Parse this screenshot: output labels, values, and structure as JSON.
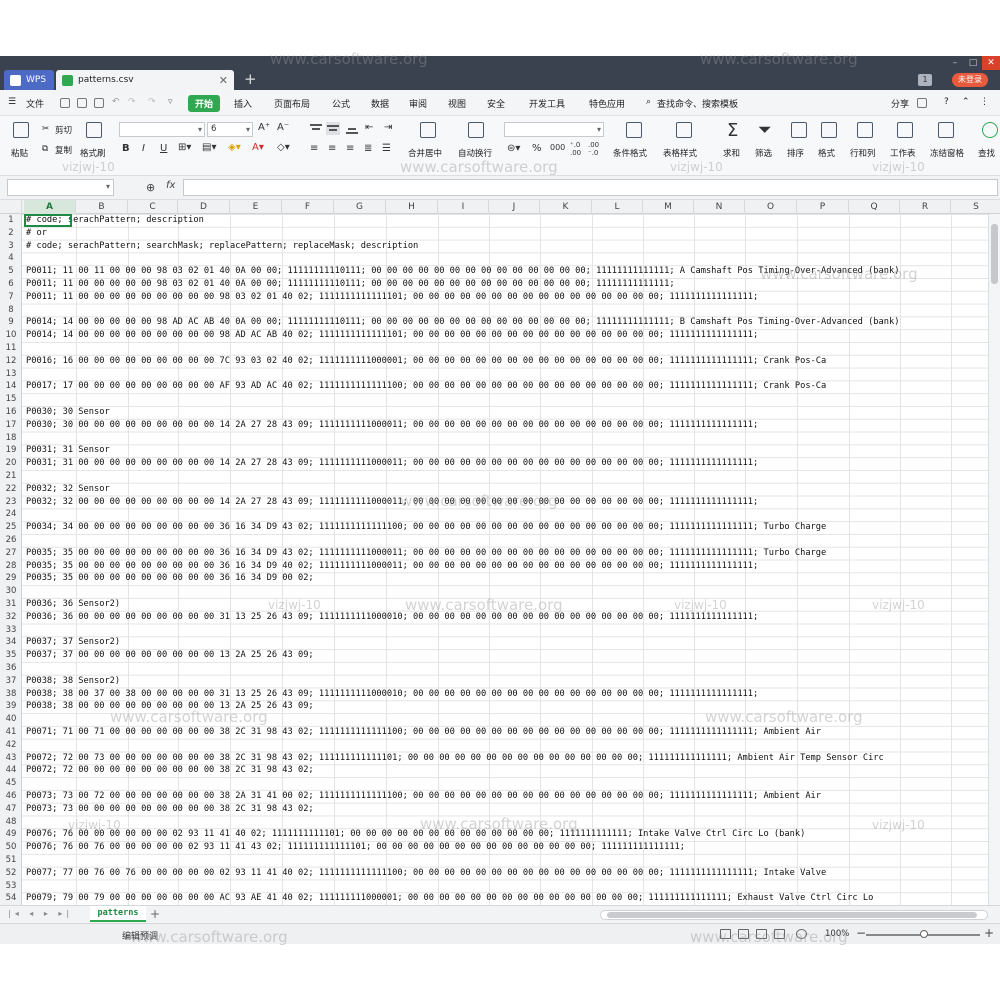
{
  "titlebar": {
    "app_tab": "WPS",
    "file_tab": "patterns.csv",
    "new_tab": "+",
    "badge": "1",
    "login": "未登录"
  },
  "menu": {
    "items": [
      "文件",
      "开始",
      "插入",
      "页面布局",
      "公式",
      "数据",
      "审阅",
      "视图",
      "安全",
      "开发工具",
      "特色应用"
    ],
    "search": "查找命令、搜索模板",
    "share": "分享",
    "help": "?"
  },
  "ribbon": {
    "paste": "粘贴",
    "cut": "剪切",
    "copy": "复制",
    "format_painter": "格式刷",
    "font_size": "6",
    "bold": "B",
    "italic": "I",
    "underline": "U",
    "merge_center": "合并居中",
    "wrap_text": "自动换行",
    "percent": "%",
    "thousands": "000",
    "cond_format": "条件格式",
    "table_style": "表格样式",
    "sum": "求和",
    "filter": "筛选",
    "sort": "排序",
    "format": "格式",
    "rows_cols": "行和列",
    "worksheet": "工作表",
    "freeze": "冻结窗格",
    "find": "查找"
  },
  "formula_bar": {
    "fx": "fx"
  },
  "grid": {
    "columns": [
      "A",
      "B",
      "C",
      "D",
      "E",
      "F",
      "G",
      "H",
      "I",
      "J",
      "K",
      "L",
      "M",
      "N",
      "O",
      "P",
      "Q",
      "R",
      "S"
    ],
    "selected_column": "A",
    "row_count": 54,
    "rows": [
      {
        "row": 1,
        "text": "# code; serachPattern; description"
      },
      {
        "row": 2,
        "text": "# or"
      },
      {
        "row": 3,
        "text": "# code; serachPattern; searchMask; replacePattern; replaceMask; description"
      },
      {
        "row": 5,
        "text": "P0011; 11 00 11 00 00 00 98 03 02 01 40 0A 00 00; 11111111110111; 00 00 00 00 00 00 00 00 00 00 00 00 00 00; 11111111111111; A Camshaft Pos Timing-Over-Advanced (bank)"
      },
      {
        "row": 6,
        "text": "P0011; 11 00 00 00 00 00 98 03 02 01 40 0A 00 00; 11111111110111; 00 00 00 00 00 00 00 00 00 00 00 00 00 00; 11111111111111;"
      },
      {
        "row": 7,
        "text": "P0011; 11 00 00 00 00 00 00 00 00 00 98 03 02 01 40 02; 1111111111111101; 00 00 00 00 00 00 00 00 00 00 00 00 00 00 00 00; 1111111111111111;"
      },
      {
        "row": 9,
        "text": "P0014; 14 00 00 00 00 00 98 AD AC AB 40 0A 00 00; 11111111110111; 00 00 00 00 00 00 00 00 00 00 00 00 00 00; 11111111111111; B Camshaft Pos Timing-Over-Advanced (bank)"
      },
      {
        "row": 10,
        "text": "P0014; 14 00 00 00 00 00 00 00 00 00 98 AD AC AB 40 02; 1111111111111101; 00 00 00 00 00 00 00 00 00 00 00 00 00 00 00 00; 1111111111111111;"
      },
      {
        "row": 12,
        "text": "P0016; 16 00 00 00 00 00 00 00 00 00 7C 93 03 02 40 02; 1111111111000001; 00 00 00 00 00 00 00 00 00 00 00 00 00 00 00 00; 1111111111111111; Crank Pos-Ca"
      },
      {
        "row": 14,
        "text": "P0017; 17 00 00 00 00 00 00 00 00 00 AF 93 AD AC 40 02; 1111111111111100; 00 00 00 00 00 00 00 00 00 00 00 00 00 00 00 00; 1111111111111111; Crank Pos-Ca"
      },
      {
        "row": 16,
        "text": "P0030; 30 Sensor"
      },
      {
        "row": 17,
        "text": "P0030; 30 00 00 00 00 00 00 00 00 00 14 2A 27 28 43 09; 1111111111000011; 00 00 00 00 00 00 00 00 00 00 00 00 00 00 00 00; 1111111111111111;"
      },
      {
        "row": 19,
        "text": "P0031; 31 Sensor"
      },
      {
        "row": 20,
        "text": "P0031; 31 00 00 00 00 00 00 00 00 00 14 2A 27 28 43 09; 1111111111000011; 00 00 00 00 00 00 00 00 00 00 00 00 00 00 00 00; 1111111111111111;"
      },
      {
        "row": 22,
        "text": "P0032; 32 Sensor"
      },
      {
        "row": 23,
        "text": "P0032; 32 00 00 00 00 00 00 00 00 00 14 2A 27 28 43 09; 1111111111000011; 00 00 00 00 00 00 00 00 00 00 00 00 00 00 00 00; 1111111111111111;"
      },
      {
        "row": 25,
        "text": "P0034; 34 00 00 00 00 00 00 00 00 00 36 16 34 D9 43 02; 1111111111111100; 00 00 00 00 00 00 00 00 00 00 00 00 00 00 00 00; 1111111111111111; Turbo Charge"
      },
      {
        "row": 27,
        "text": "P0035; 35 00 00 00 00 00 00 00 00 00 36 16 34 D9 43 02; 1111111111000011; 00 00 00 00 00 00 00 00 00 00 00 00 00 00 00 00; 1111111111111111; Turbo Charge"
      },
      {
        "row": 28,
        "text": "P0035; 35 00 00 00 00 00 00 00 00 00 36 16 34 D9 40 02; 1111111111000011; 00 00 00 00 00 00 00 00 00 00 00 00 00 00 00 00; 1111111111111111;"
      },
      {
        "row": 29,
        "text": "P0035; 35 00 00 00 00 00 00 00 00 00 36 16 34 D9 00 02;"
      },
      {
        "row": 31,
        "text": "P0036; 36 Sensor2)"
      },
      {
        "row": 32,
        "text": "P0036; 36 00 00 00 00 00 00 00 00 00 31 13 25 26 43 09; 1111111111000010; 00 00 00 00 00 00 00 00 00 00 00 00 00 00 00 00; 1111111111111111;"
      },
      {
        "row": 34,
        "text": "P0037; 37 Sensor2)"
      },
      {
        "row": 35,
        "text": "P0037; 37 00 00 00 00 00 00 00 00 00 13 2A 25 26 43 09;"
      },
      {
        "row": 37,
        "text": "P0038; 38 Sensor2)"
      },
      {
        "row": 38,
        "text": "P0038; 38 00 37 00 38 00 00 00 00 00 31 13 25 26 43 09; 1111111111000010; 00 00 00 00 00 00 00 00 00 00 00 00 00 00 00 00; 1111111111111111;"
      },
      {
        "row": 39,
        "text": "P0038; 38 00 00 00 00 00 00 00 00 00 13 2A 25 26 43 09;"
      },
      {
        "row": 41,
        "text": "P0071; 71 00 71 00 00 00 00 00 00 00 38 2C 31 98 43 02; 1111111111111100; 00 00 00 00 00 00 00 00 00 00 00 00 00 00 00 00; 1111111111111111; Ambient Air"
      },
      {
        "row": 43,
        "text": "P0072; 72 00 73 00 00 00 00 00 00 00 38 2C 31 98 43 02; 111111111111101; 00 00 00 00 00 00 00 00 00 00 00 00 00 00 00; 111111111111111; Ambient Air Temp Sensor Circ"
      },
      {
        "row": 44,
        "text": "P0072; 72 00 00 00 00 00 00 00 00 00 38 2C 31 98 43 02;"
      },
      {
        "row": 46,
        "text": "P0073; 73 00 72 00 00 00 00 00 00 00 38 2A 31 41 00 02; 1111111111111100; 00 00 00 00 00 00 00 00 00 00 00 00 00 00 00 00; 1111111111111111; Ambient Air"
      },
      {
        "row": 47,
        "text": "P0073; 73 00 00 00 00 00 00 00 00 00 38 2C 31 98 43 02;"
      },
      {
        "row": 49,
        "text": "P0076; 76 00 00 00 00 00 00 02 93 11 41 40 02; 1111111111101; 00 00 00 00 00 00 00 00 00 00 00 00 00; 1111111111111; Intake Valve Ctrl Circ Lo (bank)"
      },
      {
        "row": 50,
        "text": "P0076; 76 00 76 00 00 00 00 00 02 93 11 41 43 02; 111111111111101; 00 00 00 00 00 00 00 00 00 00 00 00 00 00; 111111111111111;"
      },
      {
        "row": 52,
        "text": "P0077; 77 00 76 00 76 00 00 00 00 00 02 93 11 41 40 02; 1111111111111100; 00 00 00 00 00 00 00 00 00 00 00 00 00 00 00 00; 1111111111111111; Intake Valve"
      },
      {
        "row": 54,
        "text": "P0079; 79 00 79 00 00 00 00 00 00 00 AC 93 AE 41 40 02; 111111111000001; 00 00 00 00 00 00 00 00 00 00 00 00 00 00 00; 111111111111111; Exhaust Valve Ctrl Circ Lo"
      }
    ]
  },
  "sheets": {
    "active": "patterns",
    "add": "+"
  },
  "status": {
    "mode": "编辑预调",
    "zoom": "100%",
    "zoom_level": 1.0
  },
  "watermark": {
    "text": "www.carsoftware.org",
    "tag": "vizjwj-10"
  }
}
